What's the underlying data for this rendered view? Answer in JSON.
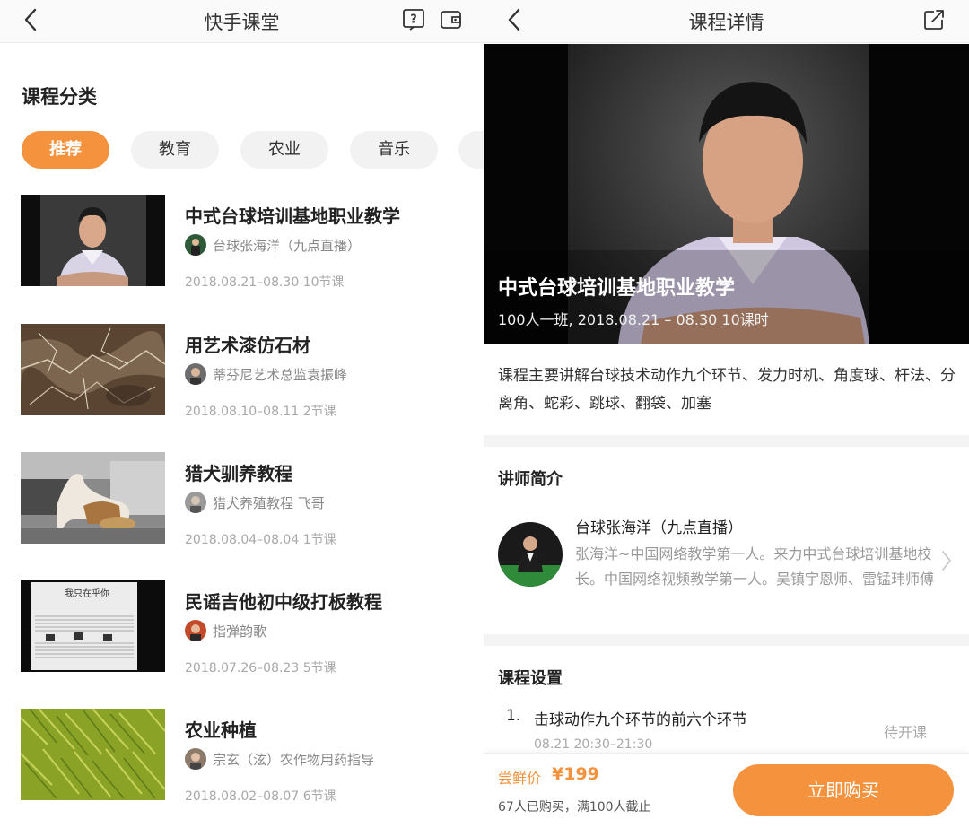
{
  "colors": {
    "accent": "#f5923e",
    "muted_text": "#999999"
  },
  "left": {
    "nav": {
      "title": "快手课堂",
      "back_icon": "chevron-left-icon",
      "help_icon": "question-box-icon",
      "wallet_icon": "wallet-icon"
    },
    "category_title": "课程分类",
    "categories": [
      {
        "label": "推荐",
        "active": true
      },
      {
        "label": "教育",
        "active": false
      },
      {
        "label": "农业",
        "active": false
      },
      {
        "label": "音乐",
        "active": false
      }
    ],
    "courses": [
      {
        "title": "中式台球培训基地职业教学",
        "author": "台球张海洋（九点直播）",
        "meta": "2018.08.21–08.30 10节课"
      },
      {
        "title": "用艺术漆仿石材",
        "author": "蒂芬尼艺术总监袁振峰",
        "meta": "2018.08.10–08.11 2节课"
      },
      {
        "title": "猎犬驯养教程",
        "author": "猎犬养殖教程 飞哥",
        "meta": "2018.08.04–08.04 1节课"
      },
      {
        "title": "民谣吉他初中级打板教程",
        "author": "指弹韵歌",
        "meta": "2018.07.26–08.23 5节课",
        "thumb_text": "我只在乎你"
      },
      {
        "title": "农业种植",
        "author": "宗玄（泫）农作物用药指导",
        "meta": "2018.08.02–08.07 6节课"
      }
    ]
  },
  "right": {
    "nav": {
      "title": "课程详情",
      "back_icon": "chevron-left-icon",
      "share_icon": "share-icon"
    },
    "hero": {
      "title": "中式台球培训基地职业教学",
      "subtitle": "100人一班, 2018.08.21 – 08.30 10课时"
    },
    "description": "课程主要讲解台球技术动作九个环节、发力时机、角度球、杆法、分离角、蛇彩、跳球、翻袋、加塞",
    "teacher": {
      "heading": "讲师简介",
      "name": "台球张海洋（九点直播）",
      "bio": "张海洋~中国网络教学第一人。来力中式台球培训基地校长。中国网络视频教学第一人。吴镇宇恩师、雷锰玮师傅"
    },
    "setup": {
      "heading": "课程设置",
      "lessons": [
        {
          "num": "1.",
          "name": "击球动作九个环节的前六个环节",
          "time": "08.21 20:30–21:30",
          "status": "待开课"
        }
      ]
    },
    "purchase": {
      "price_label": "尝鲜价",
      "price": "¥199",
      "buy_count": "67人已购买，满100人截止",
      "button": "立即购买"
    }
  }
}
